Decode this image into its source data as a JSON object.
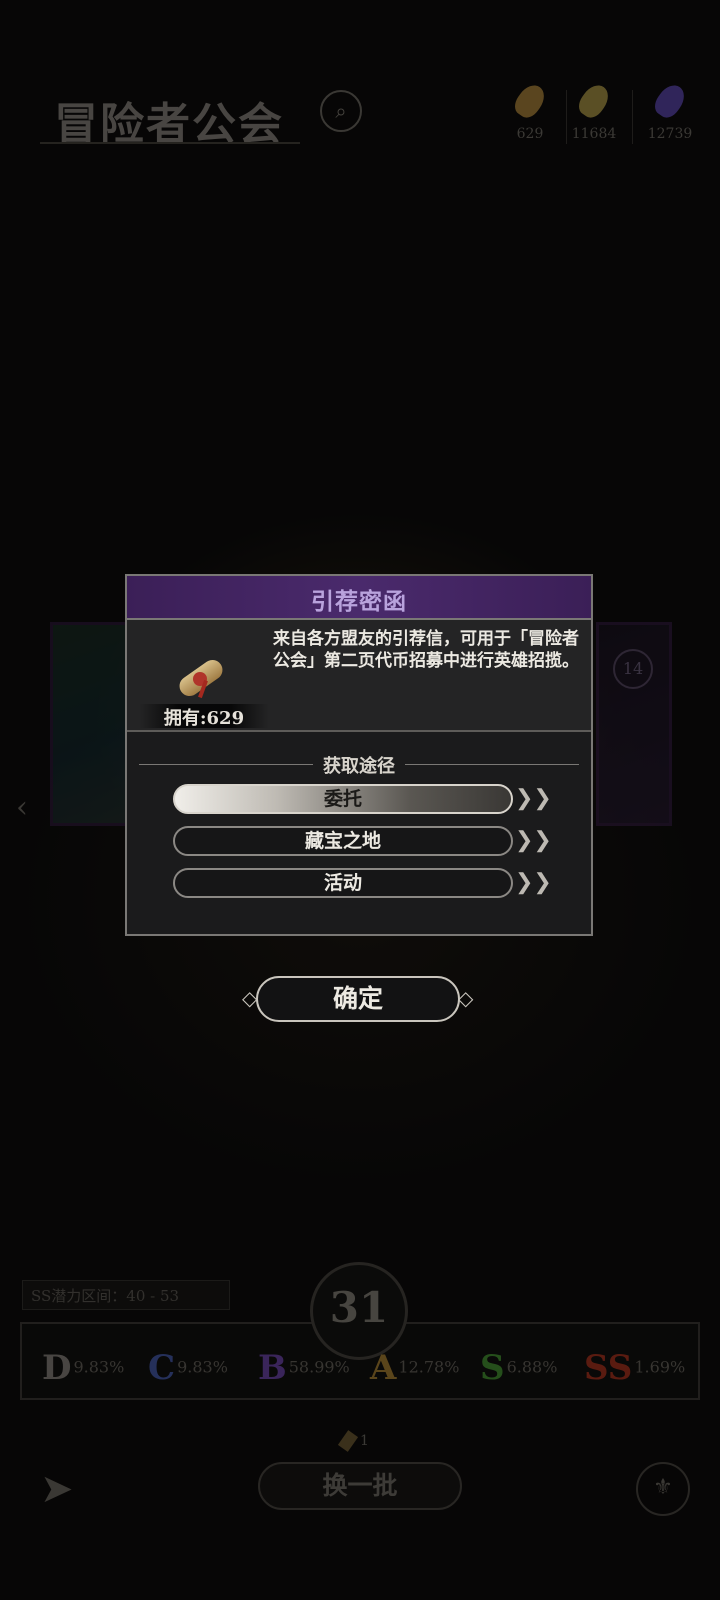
{
  "header": {
    "title": "冒险者公会",
    "search_icon": "search-icon",
    "currencies": [
      {
        "name": "recommendation-letter-icon",
        "value": "629",
        "color": "#8a6a30"
      },
      {
        "name": "gold-coin-icon",
        "value": "11684",
        "color": "#8a7a3a"
      },
      {
        "name": "purple-crystal-icon",
        "value": "12739",
        "color": "#4a3a8a"
      }
    ]
  },
  "background_cards": {
    "right_level": "14"
  },
  "dialog": {
    "title": "引荐密函",
    "item_owned": "拥有:629",
    "description": "来自各方盟友的引荐信，可用于「冒险者公会」第二页代币招募中进行英雄招揽。",
    "source_header": "获取途径",
    "sources": [
      {
        "label": "委托",
        "active": true
      },
      {
        "label": "藏宝之地",
        "active": false
      },
      {
        "label": "活动",
        "active": false
      }
    ],
    "confirm_label": "确定"
  },
  "stats": {
    "range_label": "SS潜力区间：40 - 53",
    "pity_count": "31",
    "grades": [
      {
        "grade": "D",
        "pct": "9.83%",
        "color": "#6f6b66"
      },
      {
        "grade": "C",
        "pct": "9.83%",
        "color": "#3a4a8a"
      },
      {
        "grade": "B",
        "pct": "58.99%",
        "color": "#5a3a8a"
      },
      {
        "grade": "A",
        "pct": "12.78%",
        "color": "#8a6a2a"
      },
      {
        "grade": "S",
        "pct": "6.88%",
        "color": "#3a7a2a"
      },
      {
        "grade": "SS",
        "pct": "1.69%",
        "color": "#8a2a1a"
      }
    ]
  },
  "bottom": {
    "refresh_cost": "1",
    "refresh_label": "换一批"
  },
  "colors": {
    "dialog_header": "#4a2a6c",
    "dialog_title": "#b9a3dd"
  }
}
